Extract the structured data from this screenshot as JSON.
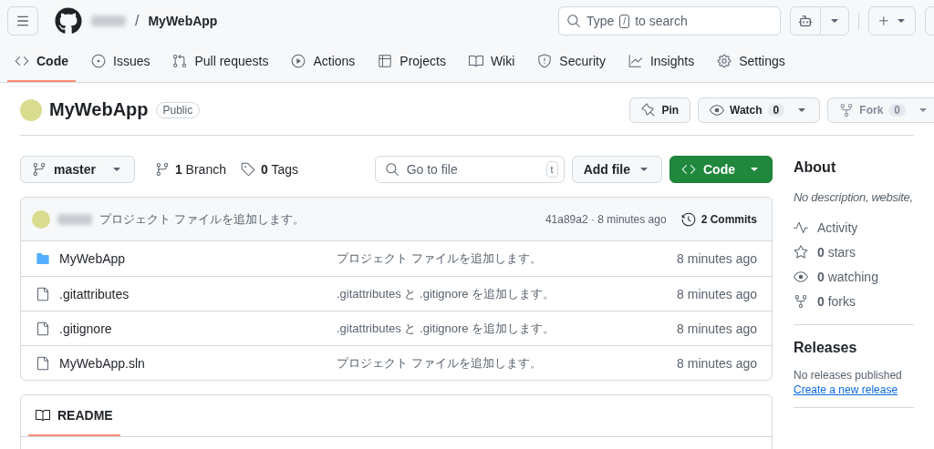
{
  "header": {
    "repo_name": "MyWebApp",
    "separator": "/",
    "search": {
      "hint_start": "Type",
      "key": "/",
      "hint_end": "to search"
    }
  },
  "tabs": [
    {
      "label": "Code",
      "selected": true
    },
    {
      "label": "Issues",
      "selected": false
    },
    {
      "label": "Pull requests",
      "selected": false
    },
    {
      "label": "Actions",
      "selected": false
    },
    {
      "label": "Projects",
      "selected": false
    },
    {
      "label": "Wiki",
      "selected": false
    },
    {
      "label": "Security",
      "selected": false
    },
    {
      "label": "Insights",
      "selected": false
    },
    {
      "label": "Settings",
      "selected": false
    }
  ],
  "repo": {
    "name": "MyWebApp",
    "visibility": "Public",
    "actions": [
      {
        "kind": "pin",
        "label": "Pin",
        "disabled": false
      },
      {
        "kind": "watch",
        "label": "Watch",
        "count": "0",
        "disabled": false
      },
      {
        "kind": "fork",
        "label": "Fork",
        "count": "0",
        "disabled": true
      }
    ]
  },
  "toolbar": {
    "branch": "master",
    "branches": "**1** Branch",
    "tags": "**0** Tags",
    "goto": {
      "placeholder": "Go to file",
      "key": "t"
    },
    "add_file": "Add file",
    "code": "Code"
  },
  "commit": {
    "message": "プロジェクト ファイルを追加します。",
    "meta": "41a89a2 · 8 minutes ago",
    "commits": "2 Commits"
  },
  "files": [
    {
      "kind": "folder",
      "name": "MyWebApp",
      "message": "プロジェクト ファイルを追加します。",
      "time": "8 minutes ago"
    },
    {
      "kind": "file",
      "name": ".gitattributes",
      "message": ".gitattributes と .gitignore を追加します。",
      "time": "8 minutes ago"
    },
    {
      "kind": "file",
      "name": ".gitignore",
      "message": ".gitattributes と .gitignore を追加します。",
      "time": "8 minutes ago"
    },
    {
      "kind": "file",
      "name": "MyWebApp.sln",
      "message": "プロジェクト ファイルを追加します。",
      "time": "8 minutes ago"
    }
  ],
  "readme": {
    "title": "README"
  },
  "sidebar": {
    "about": {
      "title": "About",
      "description": "No description, website,",
      "stats": [
        {
          "text": "Activity"
        },
        {
          "text": "**0** stars"
        },
        {
          "text": "**0** watching"
        },
        {
          "text": "**0** forks"
        }
      ]
    },
    "releases": {
      "title": "Releases",
      "text": "No releases published",
      "link": "Create a new release"
    }
  }
}
